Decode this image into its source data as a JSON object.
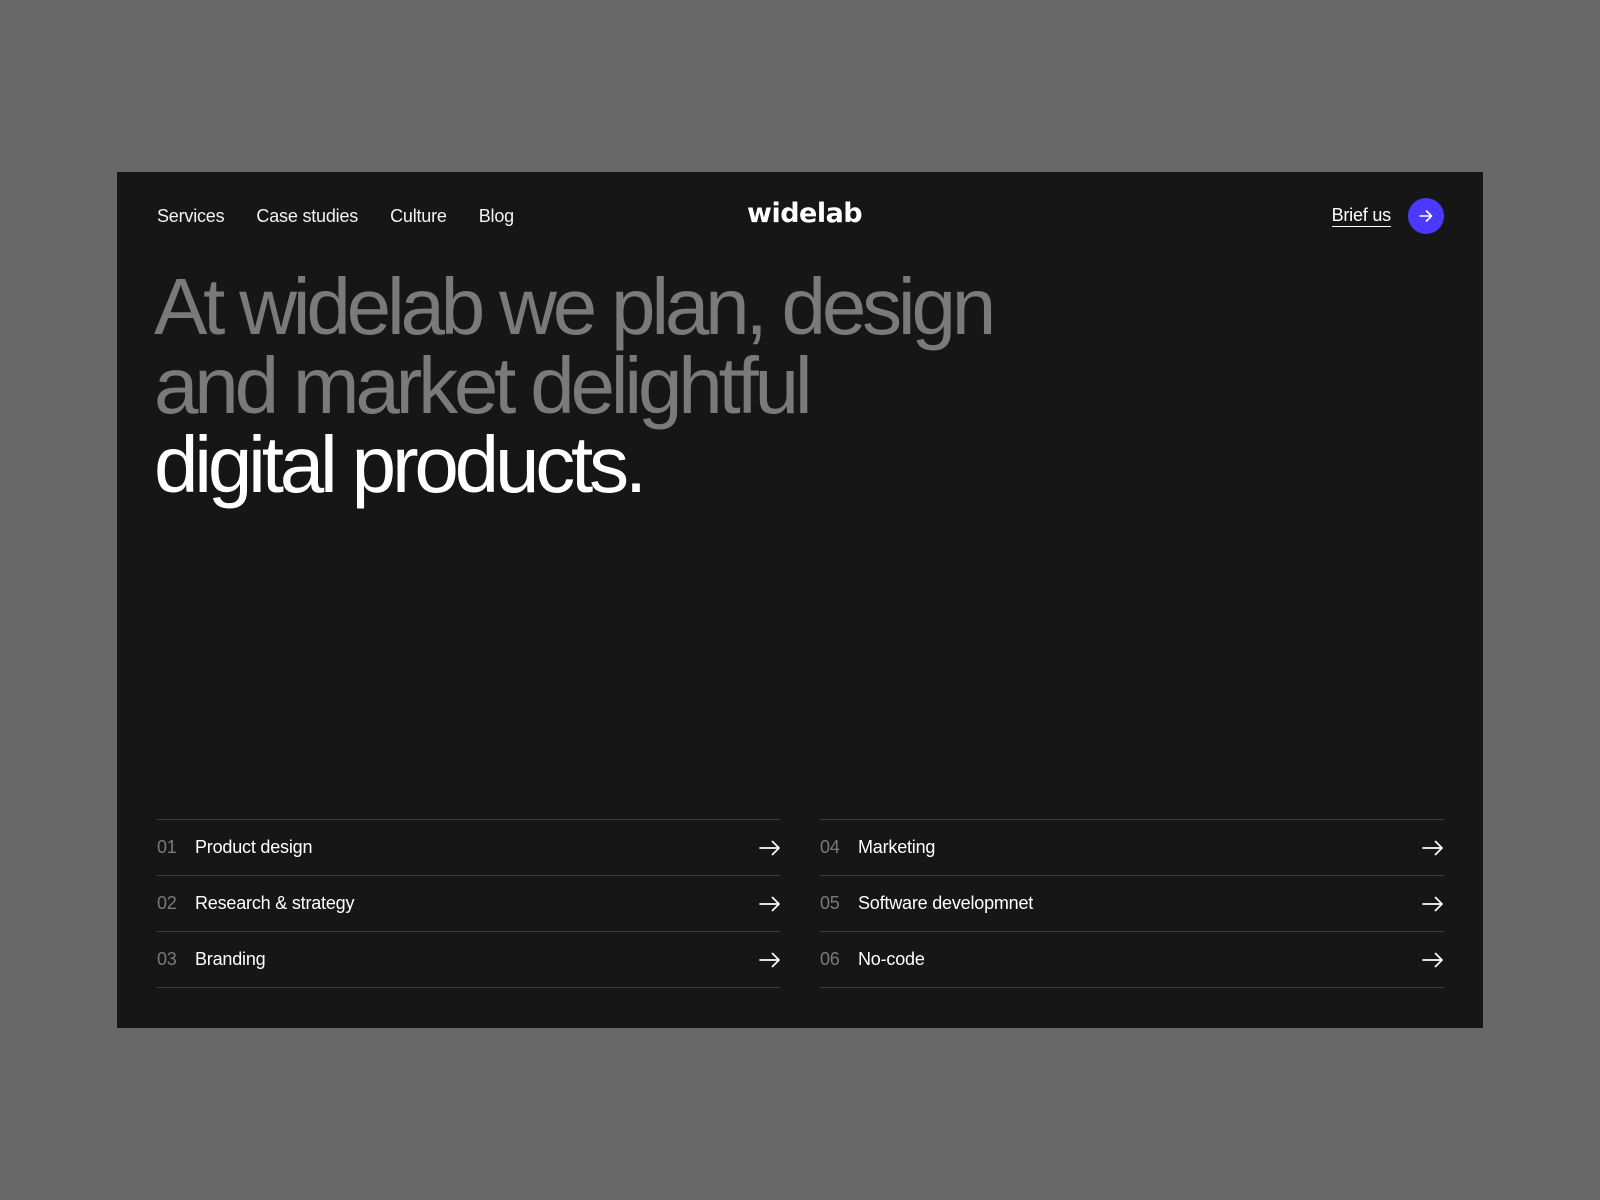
{
  "header": {
    "nav": [
      {
        "label": "Services"
      },
      {
        "label": "Case studies"
      },
      {
        "label": "Culture"
      },
      {
        "label": "Blog"
      }
    ],
    "logo": "widelab",
    "cta_label": "Brief us",
    "cta_icon": "arrow-right-icon"
  },
  "hero": {
    "line1": "At widelab we plan, design",
    "line2": "and market delightful",
    "line3": "digital products."
  },
  "services": {
    "left": [
      {
        "num": "01",
        "label": "Product design",
        "icon": "arrow-right-icon"
      },
      {
        "num": "02",
        "label": "Research & strategy",
        "icon": "arrow-right-icon"
      },
      {
        "num": "03",
        "label": "Branding",
        "icon": "arrow-right-icon"
      }
    ],
    "right": [
      {
        "num": "04",
        "label": "Marketing",
        "icon": "arrow-right-icon"
      },
      {
        "num": "05",
        "label": "Software developmnet",
        "icon": "arrow-right-icon"
      },
      {
        "num": "06",
        "label": "No-code",
        "icon": "arrow-right-icon"
      }
    ]
  },
  "colors": {
    "background": "#161616",
    "page_backdrop": "#686868",
    "accent": "#4a3aff",
    "muted_text": "#7a7a7a",
    "text": "#ffffff",
    "divider": "#3a3a3a"
  }
}
